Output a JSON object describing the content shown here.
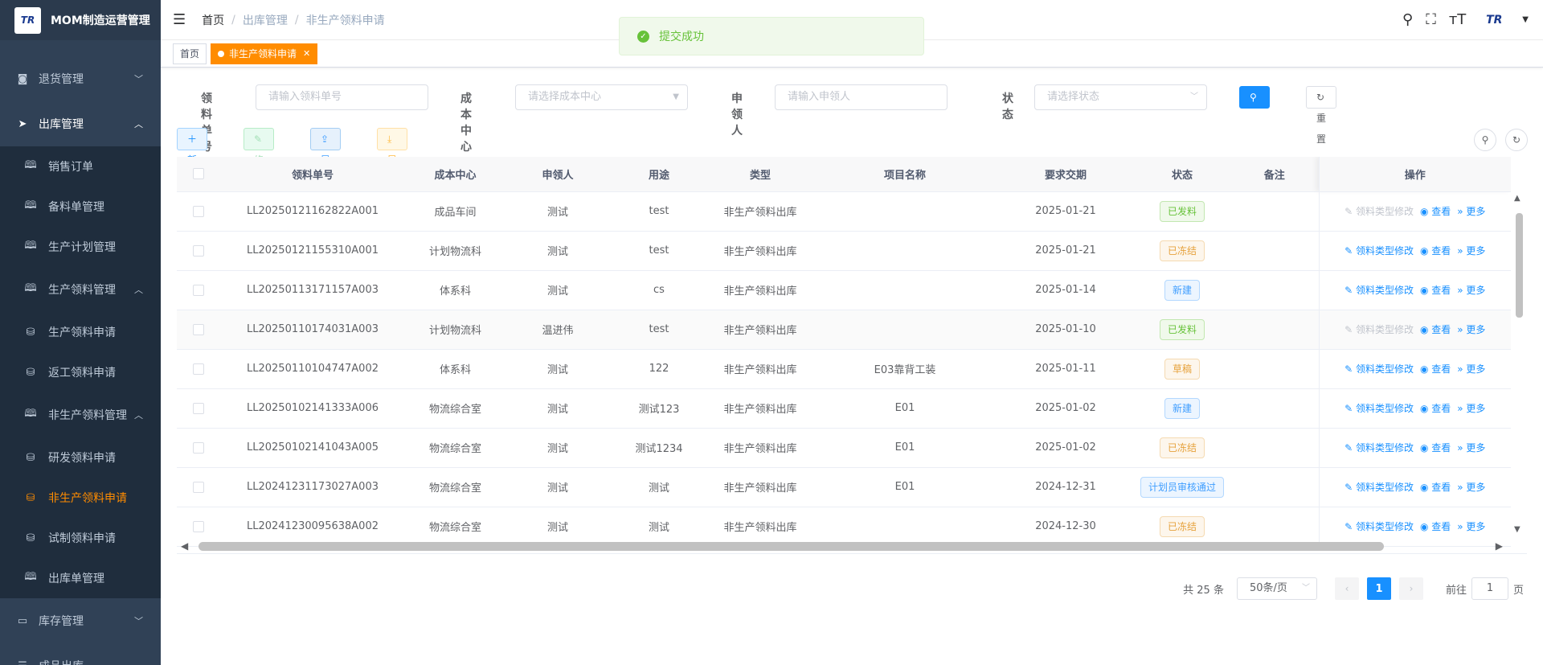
{
  "app": {
    "logo_text": "TR",
    "title": "MOM制造运营管理"
  },
  "sidebar": {
    "top_items": [
      {
        "label": "退货管理",
        "icon": "return-icon"
      },
      {
        "label": "出库管理",
        "icon": "send-icon"
      }
    ],
    "outbound_children": [
      {
        "label": "销售订单",
        "icon": "book-icon"
      },
      {
        "label": "备料单管理",
        "icon": "book-icon"
      },
      {
        "label": "生产计划管理",
        "icon": "book-icon"
      },
      {
        "label": "生产领料管理",
        "icon": "book-icon"
      }
    ],
    "production_children": [
      {
        "label": "生产领料申请",
        "icon": "bag-icon"
      },
      {
        "label": "返工领料申请",
        "icon": "bag-icon"
      }
    ],
    "nonprod_group": {
      "label": "非生产领料管理",
      "icon": "book-icon"
    },
    "nonprod_children": [
      {
        "label": "研发领料申请",
        "icon": "bag-icon"
      },
      {
        "label": "非生产领料申请",
        "icon": "bag-icon"
      },
      {
        "label": "试制领料申请",
        "icon": "bag-icon"
      }
    ],
    "outbound_manage": {
      "label": "出库单管理",
      "icon": "book-icon"
    },
    "bottom_items": [
      {
        "label": "库存管理",
        "icon": "monitor-icon"
      },
      {
        "label": "成品出库",
        "icon": "list-icon"
      }
    ]
  },
  "header": {
    "breadcrumb": [
      "首页",
      "出库管理",
      "非生产领料申请"
    ],
    "avatar_text": "TR"
  },
  "tags": {
    "home": "首页",
    "active": "非生产领料申请"
  },
  "toast": {
    "message": "提交成功"
  },
  "search": {
    "order_no_label": "领料单号",
    "order_no_placeholder": "请输入领料单号",
    "cost_center_label": "成本中心",
    "cost_center_placeholder": "请选择成本中心",
    "applicant_label": "申领人",
    "applicant_placeholder": "请输入申领人",
    "status_label": "状态",
    "status_placeholder": "请选择状态",
    "search_btn": "搜索",
    "reset_btn": "重置"
  },
  "toolbar": {
    "add": "新增",
    "edit": "修改",
    "import": "导入",
    "export": "导出"
  },
  "table": {
    "headers": [
      "领料单号",
      "成本中心",
      "申领人",
      "用途",
      "类型",
      "项目名称",
      "要求交期",
      "状态",
      "备注",
      "操作"
    ],
    "op_labels": {
      "modify": "领料类型修改",
      "view": "查看",
      "more": "更多"
    },
    "rows": [
      {
        "no": "LL20250121162822A001",
        "center": "成品车间",
        "applicant": "测试",
        "purpose": "test",
        "type": "非生产领料出库",
        "project": "",
        "date": "2025-01-21",
        "status": "已发料",
        "status_color": "green",
        "remark": "",
        "modify_disabled": true
      },
      {
        "no": "LL20250121155310A001",
        "center": "计划物流科",
        "applicant": "测试",
        "purpose": "test",
        "type": "非生产领料出库",
        "project": "",
        "date": "2025-01-21",
        "status": "已冻结",
        "status_color": "orange",
        "remark": "",
        "modify_disabled": false
      },
      {
        "no": "LL20250113171157A003",
        "center": "体系科",
        "applicant": "测试",
        "purpose": "cs",
        "type": "非生产领料出库",
        "project": "",
        "date": "2025-01-14",
        "status": "新建",
        "status_color": "blue",
        "remark": "",
        "modify_disabled": false
      },
      {
        "no": "LL20250110174031A003",
        "center": "计划物流科",
        "applicant": "温进伟",
        "purpose": "test",
        "type": "非生产领料出库",
        "project": "",
        "date": "2025-01-10",
        "status": "已发料",
        "status_color": "green",
        "remark": "",
        "modify_disabled": true
      },
      {
        "no": "LL20250110104747A002",
        "center": "体系科",
        "applicant": "测试",
        "purpose": "122",
        "type": "非生产领料出库",
        "project": "E03靠背工装",
        "date": "2025-01-11",
        "status": "草稿",
        "status_color": "orange",
        "remark": "",
        "modify_disabled": false
      },
      {
        "no": "LL20250102141333A006",
        "center": "物流综合室",
        "applicant": "测试",
        "purpose": "测试123",
        "type": "非生产领料出库",
        "project": "E01",
        "date": "2025-01-02",
        "status": "新建",
        "status_color": "blue",
        "remark": "",
        "modify_disabled": false
      },
      {
        "no": "LL20250102141043A005",
        "center": "物流综合室",
        "applicant": "测试",
        "purpose": "测试1234",
        "type": "非生产领料出库",
        "project": "E01",
        "date": "2025-01-02",
        "status": "已冻结",
        "status_color": "orange",
        "remark": "",
        "modify_disabled": false
      },
      {
        "no": "LL20241231173027A003",
        "center": "物流综合室",
        "applicant": "测试",
        "purpose": "测试",
        "type": "非生产领料出库",
        "project": "E01",
        "date": "2024-12-31",
        "status": "计划员审核通过",
        "status_color": "blue",
        "remark": "",
        "modify_disabled": false
      },
      {
        "no": "LL20241230095638A002",
        "center": "物流综合室",
        "applicant": "测试",
        "purpose": "测试",
        "type": "非生产领料出库",
        "project": "",
        "date": "2024-12-30",
        "status": "已冻结",
        "status_color": "orange",
        "remark": "",
        "modify_disabled": false
      }
    ]
  },
  "pagination": {
    "total": "共 25 条",
    "page_size": "50条/页",
    "current": "1",
    "goto_label": "前往",
    "goto_value": "1",
    "page_unit": "页"
  }
}
